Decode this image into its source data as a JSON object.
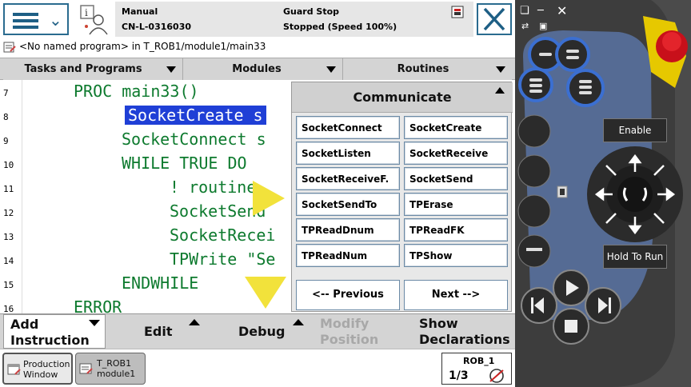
{
  "header": {
    "mode": "Manual",
    "controller": "CN-L-0316030",
    "safety_state": "Guard Stop",
    "run_state": "Stopped (Speed 100%)"
  },
  "program_line": "<No named program> in T_ROB1/module1/main33",
  "tabs": [
    {
      "label": "Tasks and Programs"
    },
    {
      "label": "Modules"
    },
    {
      "label": "Routines"
    }
  ],
  "editor": {
    "lines": [
      {
        "num": "7",
        "text": "PROC main33()"
      },
      {
        "num": "8",
        "text": "SocketCreate s"
      },
      {
        "num": "9",
        "text": "SocketConnect s"
      },
      {
        "num": "10",
        "text": "WHILE TRUE DO"
      },
      {
        "num": "11",
        "text": "! routine"
      },
      {
        "num": "12",
        "text": "SocketSend"
      },
      {
        "num": "13",
        "text": "SocketRecei"
      },
      {
        "num": "14",
        "text": "TPWrite \"Se"
      },
      {
        "num": "15",
        "text": "ENDWHILE"
      },
      {
        "num": "16",
        "text": "ERROR"
      }
    ]
  },
  "popup": {
    "title": "Communicate",
    "items": [
      "SocketConnect",
      "SocketCreate",
      "SocketListen",
      "SocketReceive",
      "SocketReceiveF.",
      "SocketSend",
      "SocketSendTo",
      "TPErase",
      "TPReadDnum",
      "TPReadFK",
      "TPReadNum",
      "TPShow"
    ],
    "previous_label": "<-- Previous",
    "next_label": "Next -->"
  },
  "bottom": {
    "add_instruction": "Add\nInstruction",
    "edit": "Edit",
    "debug": "Debug",
    "modify_position": "Modify\nPosition",
    "show_declarations": "Show\nDeclarations"
  },
  "taskbar": {
    "production_window": "Production\nWindow",
    "module_window": "T_ROB1\nmodule1",
    "robot": "ROB_1",
    "increment": "1/3"
  },
  "hardware": {
    "enable_label": "Enable",
    "hold_label": "Hold To Run"
  },
  "colors": {
    "code_green": "#0d7a2e",
    "highlight_blue": "#1f3fd6",
    "arrow_yellow": "#f2e23b",
    "pendant_body": "#4a4a4a",
    "pendant_accent": "#3b6fd1"
  }
}
